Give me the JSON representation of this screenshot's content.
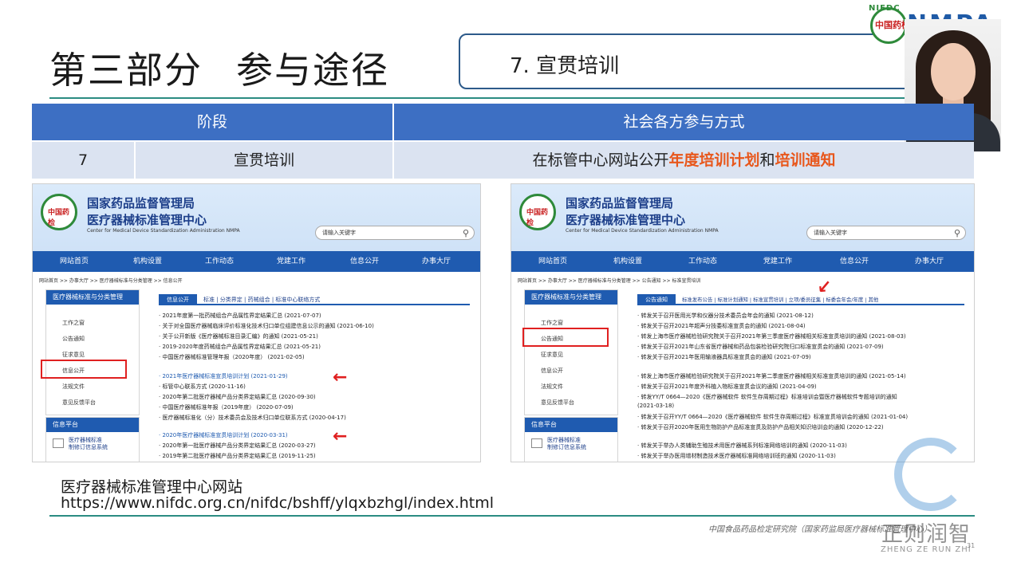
{
  "section_title_part1": "第三部分",
  "section_title_part2": "参与途径",
  "subtitle": "7. 宣贯培训",
  "logo_text": "NMPA",
  "logo_arc": "NIFDC",
  "logo_red": "中国药检",
  "table": {
    "headers": [
      "阶段",
      "社会各方参与方式"
    ],
    "row": {
      "num": "7",
      "stage": "宣贯培训",
      "method_prefix": "在标管中心网站公开",
      "hl1": "年度培训计划",
      "mid": "和",
      "hl2": "培训通知"
    }
  },
  "website": {
    "title1": "国家药品监督管理局",
    "title2": "医疗器械标准管理中心",
    "title3": "Center for Medical Device Standardization Administration NMPA",
    "search_placeholder": "请输入关键字",
    "nav": [
      "网站首页",
      "机构设置",
      "工作动态",
      "党建工作",
      "信息公开",
      "办事大厅"
    ],
    "left": {
      "breadcrumb": "网站首页 >> 办事大厅 >> 医疗器械标准与分类管理 >> 信息公开",
      "side_header": "医疗器械标准与分类管理",
      "side_items": [
        "工作之窗",
        "公告通知",
        "征求意见",
        "信息公开",
        "法规文件",
        "意见反馈平台"
      ],
      "side2_header": "信息平台",
      "side2_box": [
        "医疗器械标准",
        "制修订信息系统"
      ],
      "tab_active": "信息公开",
      "tabs_rest": "标准 | 分类界定 | 药械组合 | 标准中心联络方式",
      "items": [
        "· 2021年度第一批药械组合产品属性界定结果汇总 (2021-07-07)",
        "· 关于对全国医疗器械临床评价标准化技术归口单位组建信息公示的通知 (2021-06-10)",
        "· 关于公开新版《医疗器械标准目录汇编》的通知 (2021-05-21)",
        "· 2019-2020年度药械组合产品属性界定结果汇总 (2021-05-21)",
        "· 中国医疗器械标准管理年报（2020年度） (2021-02-05)",
        "· 2021年医疗器械标准宣贯培训计划 (2021-01-29)",
        "· 标管中心联系方式 (2020-11-16)",
        "· 2020年第二批医疗器械产品分类界定结果汇总 (2020-09-30)",
        "· 中国医疗器械标准年报（2019年度） (2020-07-09)",
        "· 医疗器械标准化（分）技术委员会及技术归口单位联系方式 (2020-04-17)",
        "· 2020年医疗器械标准宣贯培训计划 (2020-03-31)",
        "· 2020年第一批医疗器械产品分类界定结果汇总 (2020-03-27)",
        "· 2019年第二批医疗器械产品分类界定结果汇总 (2019-11-25)"
      ]
    },
    "right": {
      "breadcrumb": "网站首页 >> 办事大厅 >> 医疗器械标准与分类管理 >> 公告通知 >> 标准宣贯培训",
      "side_header": "医疗器械标准与分类管理",
      "side_items": [
        "工作之窗",
        "公告通知",
        "征求意见",
        "信息公开",
        "法规文件",
        "意见反馈平台"
      ],
      "side2_header": "信息平台",
      "side2_box": [
        "医疗器械标准",
        "制修订信息系统"
      ],
      "tab_active": "公告通知",
      "tabs_rest": "标准发布公告 | 标准计划通知 | 标准宣贯培训 | 立项/委员征集 | 标委会年会/年度 | 其他",
      "items": [
        "· 转发关于召开医用光学和仪器分技术委员会年会的通知 (2021-08-12)",
        "· 转发关于召开2021年超声分技委标准宣贯会的通知 (2021-08-04)",
        "· 转发上海市医疗器械检验研究院关于召开2021年第三季度医疗器械相关标准宣贯培训的通知 (2021-08-03)",
        "· 转发关于召开2021年山东省医疗器械和药品包装检验研究院归口标准宣贯会的通知 (2021-07-09)",
        "· 转发关于召开2021年医用输液器具标准宣贯会的通知 (2021-07-09)",
        "· 转发上海市医疗器械检验研究院关于召开2021年第二季度医疗器械相关标准宣贯培训的通知 (2021-05-14)",
        "· 转发关于召开2021年度外科植入物标准宣贯会议的通知 (2021-04-09)",
        "· 转发YY/T 0664—2020《医疗器械软件 软件生存周期过程》标准培训会暨医疗器械软件专题培训的通知",
        "  (2021-03-18)",
        "· 转发关于召开YY/T 0664—2020《医疗器械软件 软件生存周期过程》标准宣贯培训会的通知 (2021-01-04)",
        "· 转发关于召开2020年医用生物防护产品标准宣贯及防护产品相关知识培训会的通知 (2020-12-22)",
        "· 转发关于举办人类辅助生殖技术用医疗器械系列标准网络培训的通知 (2020-11-03)",
        "· 转发关于举办医用增材制造技术医疗器械标准网络培训班的通知 (2020-11-03)"
      ]
    }
  },
  "caption_name": "医疗器械标准管理中心网站",
  "caption_url": "https://www.nifdc.org.cn/nifdc/bshff/ylqxbzhgl/index.html",
  "footer": "中国食品药品检定研究院（国家药监局医疗器械标准管理中心）",
  "page_num": "31",
  "watermark_cn": "正则润智",
  "watermark_en": "ZHENG ZE RUN ZHI",
  "colors": {
    "header_blue": "#3d6fc3",
    "row_bg": "#dbe3f1",
    "highlight": "#e8571c",
    "accent_line": "#2b8c82"
  }
}
